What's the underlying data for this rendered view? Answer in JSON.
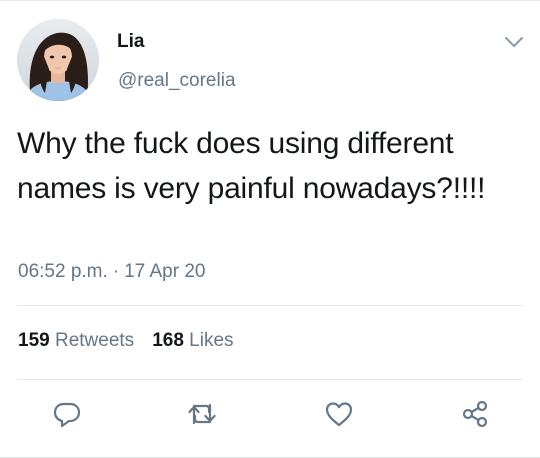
{
  "user": {
    "display_name": "Lia",
    "handle": "@real_corelia"
  },
  "tweet": {
    "text": "Why the fuck does using different names is very painful nowadays?!!!!",
    "time": "06:52 p.m.",
    "separator": "·",
    "date": "17 Apr 20"
  },
  "stats": {
    "retweets_count": "159",
    "retweets_label": "Retweets",
    "likes_count": "168",
    "likes_label": "Likes"
  },
  "actions": {
    "reply_icon": "reply-icon",
    "retweet_icon": "retweet-icon",
    "like_icon": "heart-icon",
    "share_icon": "share-icon"
  },
  "colors": {
    "text_primary": "#14171a",
    "text_secondary": "#657786",
    "divider": "#e1e8ed",
    "icon": "#657786"
  }
}
